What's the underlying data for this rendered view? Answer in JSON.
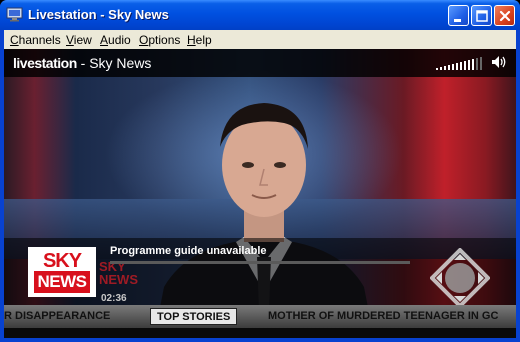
{
  "window": {
    "title": "Livestation - Sky News",
    "icon": "monitor-icon",
    "controls": [
      "minimize-icon",
      "maximize-icon",
      "close-icon"
    ]
  },
  "menu": {
    "items": [
      {
        "label": "Channels",
        "key": "C",
        "rest": "hannels"
      },
      {
        "label": "View",
        "key": "V",
        "rest": "iew"
      },
      {
        "label": "Audio",
        "key": "A",
        "rest": "udio"
      },
      {
        "label": "Options",
        "key": "O",
        "rest": "ptions"
      },
      {
        "label": "Help",
        "key": "H",
        "rest": "elp"
      }
    ]
  },
  "player": {
    "brand": "livestation",
    "channel": " - Sky News",
    "volume_icon": "speaker-icon",
    "volume_level": 0.8
  },
  "overlay": {
    "logo_sky": "SKY",
    "logo_news": "NEWS",
    "programme": "Programme guide unavailable",
    "progress": 0.0,
    "bg_logo_sky": "SKY",
    "bg_logo_news": "NEWS",
    "clock": "02:36",
    "nav_icon": "directional-pad-icon"
  },
  "ticker": {
    "left_text": "R DISAPPEARANCE",
    "label": "TOP STORIES",
    "right_text": "MOTHER OF MURDERED TEENAGER IN GC"
  },
  "colors": {
    "titlebar": "#0050e0",
    "menubar": "#ece9d8",
    "sky_red": "#d8101c"
  }
}
